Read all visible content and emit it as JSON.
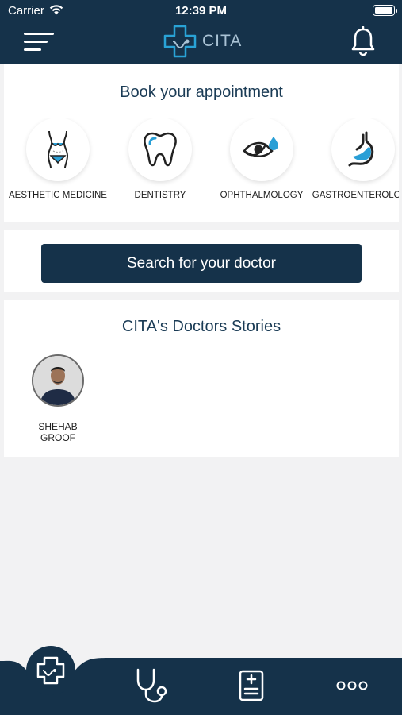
{
  "status_bar": {
    "carrier": "Carrier",
    "time": "12:39 PM"
  },
  "header": {
    "logo_text": "CITA"
  },
  "booking": {
    "title": "Book your appointment",
    "categories": [
      {
        "label": "AESTHETIC MEDICINE",
        "icon": "body-silhouette-icon"
      },
      {
        "label": "DENTISTRY",
        "icon": "tooth-icon"
      },
      {
        "label": "OPHTHALMOLOGY",
        "icon": "eye-drop-icon"
      },
      {
        "label": "GASTROENTEROLOGY",
        "icon": "stomach-icon"
      }
    ]
  },
  "search": {
    "button_label": "Search for your doctor"
  },
  "stories": {
    "title": "CITA's Doctors Stories",
    "items": [
      {
        "name": "SHEHAB GROOF"
      }
    ]
  },
  "colors": {
    "primary": "#15324a",
    "accent": "#29a3d6",
    "background": "#f2f2f3"
  },
  "tabbar": {
    "items": [
      {
        "icon": "medical-cross-icon",
        "active": true
      },
      {
        "icon": "stethoscope-icon",
        "active": false
      },
      {
        "icon": "medical-record-icon",
        "active": false
      },
      {
        "icon": "more-icon",
        "active": false
      }
    ]
  }
}
